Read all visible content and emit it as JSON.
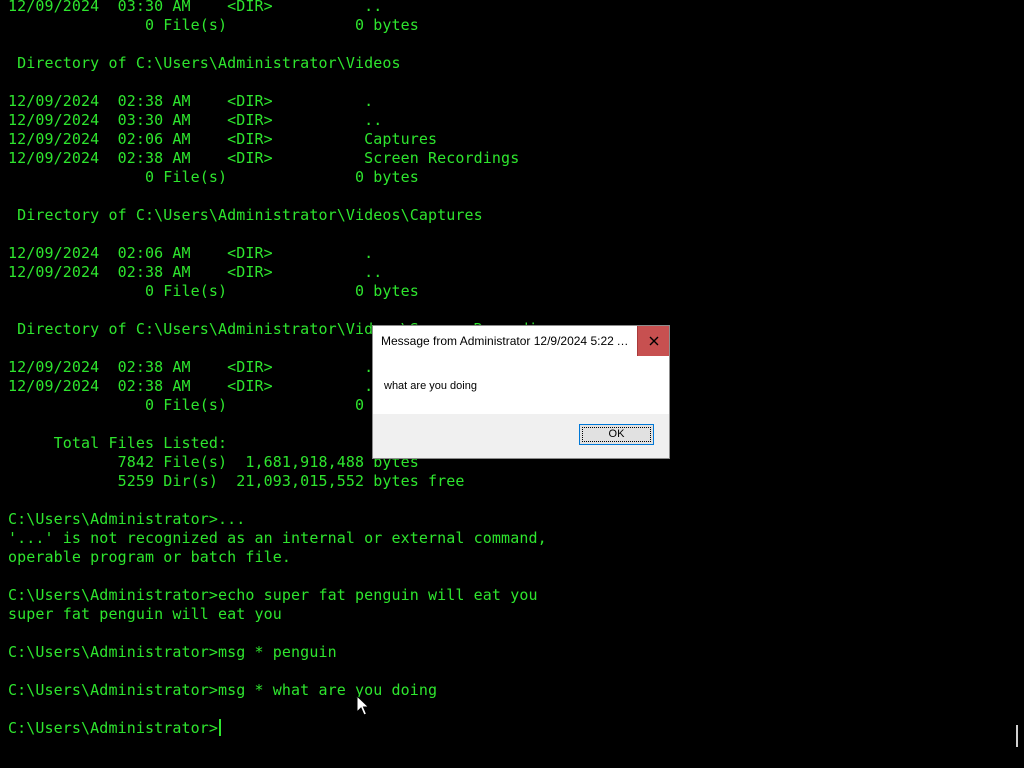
{
  "colors": {
    "console_background": "#000000",
    "console_text": "#2ee52e",
    "close_button": "#c75050",
    "dialog_face": "#f0f0f0"
  },
  "console": {
    "lines": [
      "12/09/2024  03:30 AM    <DIR>          ..",
      "               0 File(s)              0 bytes",
      "",
      " Directory of C:\\Users\\Administrator\\Videos",
      "",
      "12/09/2024  02:38 AM    <DIR>          .",
      "12/09/2024  03:30 AM    <DIR>          ..",
      "12/09/2024  02:06 AM    <DIR>          Captures",
      "12/09/2024  02:38 AM    <DIR>          Screen Recordings",
      "               0 File(s)              0 bytes",
      "",
      " Directory of C:\\Users\\Administrator\\Videos\\Captures",
      "",
      "12/09/2024  02:06 AM    <DIR>          .",
      "12/09/2024  02:38 AM    <DIR>          ..",
      "               0 File(s)              0 bytes",
      "",
      " Directory of C:\\Users\\Administrator\\Videos\\Screen Recordings",
      "",
      "12/09/2024  02:38 AM    <DIR>          .",
      "12/09/2024  02:38 AM    <DIR>          ..",
      "               0 File(s)              0 bytes",
      "",
      "     Total Files Listed:",
      "            7842 File(s)  1,681,918,488 bytes",
      "            5259 Dir(s)  21,093,015,552 bytes free",
      "",
      "C:\\Users\\Administrator>...",
      "'...' is not recognized as an internal or external command,",
      "operable program or batch file.",
      "",
      "C:\\Users\\Administrator>echo super fat penguin will eat you",
      "super fat penguin will eat you",
      "",
      "C:\\Users\\Administrator>msg * penguin",
      "",
      "C:\\Users\\Administrator>msg * what are you doing",
      ""
    ],
    "current_prompt": "C:\\Users\\Administrator>"
  },
  "dialog": {
    "title": "Message from Administrator 12/9/2024 5:22 A...",
    "close_icon": "close-icon",
    "message": "what are you doing",
    "ok_label": "OK"
  }
}
